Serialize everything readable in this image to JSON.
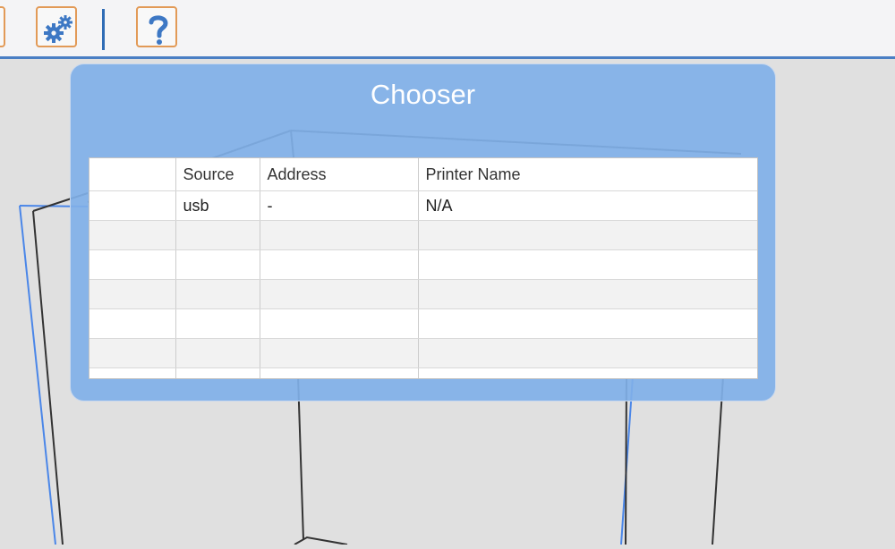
{
  "toolbar": {
    "buttons": [
      {
        "name": "settings-button",
        "icon": "gears-icon"
      },
      {
        "name": "help-button",
        "icon": "question-mark-icon"
      }
    ],
    "colors": {
      "accent": "#4a7fc4",
      "button_border": "#e29a57",
      "icon": "#3d78c4"
    }
  },
  "dialog": {
    "title": "Chooser",
    "table": {
      "columns": [
        "",
        "Source",
        "Address",
        "Printer Name"
      ],
      "rows": [
        [
          "",
          "usb",
          "-",
          "N/A"
        ]
      ]
    }
  }
}
